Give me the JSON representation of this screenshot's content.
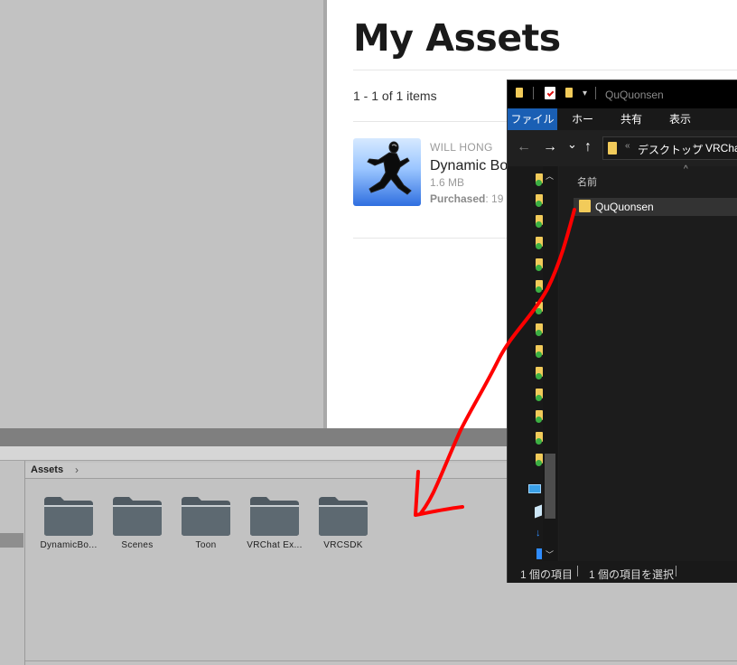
{
  "web": {
    "title": "My Assets",
    "items_count": "1 - 1 of 1 items",
    "asset": {
      "author": "WILL HONG",
      "name": "Dynamic Bo",
      "size": "1.6 MB",
      "purchased_label": "Purchased",
      "purchased_value": ": 19"
    }
  },
  "project": {
    "breadcrumb": "Assets",
    "breadcrumb_chevron": "›",
    "folders": [
      {
        "label": "DynamicBo..."
      },
      {
        "label": "Scenes"
      },
      {
        "label": "Toon"
      },
      {
        "label": "VRChat Ex..."
      },
      {
        "label": "VRCSDK"
      }
    ]
  },
  "explorer": {
    "title": "QuQuonsen",
    "tabs": {
      "file": "ファイル",
      "home": "ホーム",
      "share": "共有",
      "view": "表示"
    },
    "nav": {
      "back": "←",
      "forward": "→",
      "recent": "⌄",
      "up": "↑"
    },
    "address": {
      "prefix": "«",
      "segment1": "デスクトップ",
      "separator": "›",
      "segment2": "VRCha"
    },
    "column_header": "名前",
    "sort_indicator": "^",
    "rows": [
      {
        "name": "QuQuonsen"
      }
    ],
    "status": {
      "count": "1 個の項目",
      "selected": "1 個の項目を選択"
    }
  },
  "colors": {
    "folder_icon": "#f2cb5a",
    "file_tab": "#1a5fb4",
    "annotation_arrow": "#ff0000"
  }
}
